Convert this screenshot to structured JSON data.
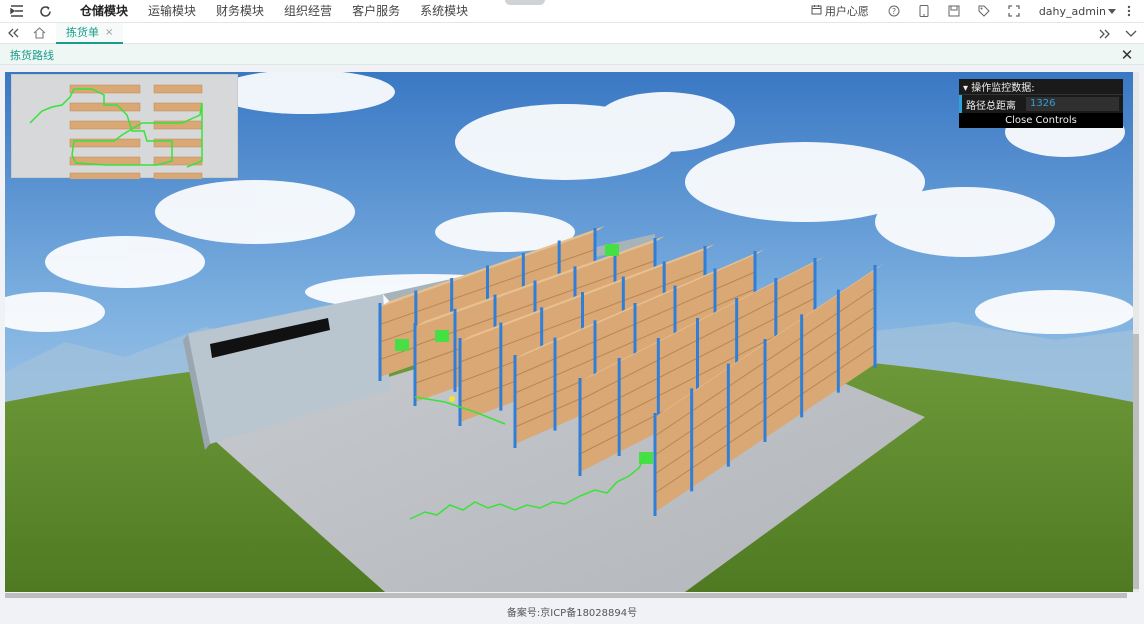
{
  "topbar": {
    "menu": [
      {
        "label": "仓储模块",
        "active": true
      },
      {
        "label": "运输模块",
        "active": false
      },
      {
        "label": "财务模块",
        "active": false
      },
      {
        "label": "组织经营",
        "active": false
      },
      {
        "label": "客户服务",
        "active": false
      },
      {
        "label": "系统模块",
        "active": false
      }
    ],
    "wish_label": "用户心愿",
    "username": "dahy_admin"
  },
  "tabs": [
    {
      "label": "拣货单",
      "closable_glyph": "×"
    }
  ],
  "page": {
    "title": "拣货路线",
    "close_glyph": "✕"
  },
  "controls": {
    "header": "▾ 操作监控数据:",
    "rows": [
      {
        "label": "路径总距离",
        "value": "1326"
      }
    ],
    "close_label": "Close Controls"
  },
  "footer": {
    "text": "备案号:京ICP备18028894号"
  },
  "colors": {
    "accent": "#1a9c8c",
    "route": "#39e239",
    "rack_blue": "#2f7fd9",
    "box": "#d9a874"
  },
  "icons": [
    "menu-fold-icon",
    "refresh-icon",
    "calendar-icon",
    "help-icon",
    "tablet-icon",
    "save-icon",
    "tag-icon",
    "fullscreen-icon",
    "more-icon",
    "double-left-icon",
    "home-icon",
    "double-right-icon",
    "chevron-down-icon"
  ]
}
